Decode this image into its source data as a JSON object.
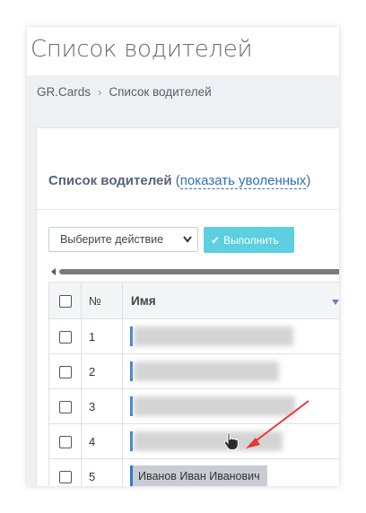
{
  "page": {
    "title": "Список водителей"
  },
  "breadcrumb": {
    "root": "GR.Cards",
    "separator": "›",
    "current": "Список водителей"
  },
  "card": {
    "title": "Список водителей",
    "paren_open": "(",
    "show_fired_link": "показать уволенных",
    "paren_close": ")"
  },
  "action_select": {
    "value": "Выберите действие"
  },
  "run_button": {
    "label": "Выполнить",
    "icon": "check-icon"
  },
  "table": {
    "columns": {
      "number": "№",
      "name": "Имя"
    },
    "rows": [
      {
        "number": "1",
        "name": ""
      },
      {
        "number": "2",
        "name": ""
      },
      {
        "number": "3",
        "name": ""
      },
      {
        "number": "4",
        "name": ""
      },
      {
        "number": "5",
        "name": "Иванов Иван Иванович"
      }
    ]
  },
  "colors": {
    "accent": "#2a7bd4",
    "button": "#5ccfe0",
    "arrow": "#e53935"
  }
}
